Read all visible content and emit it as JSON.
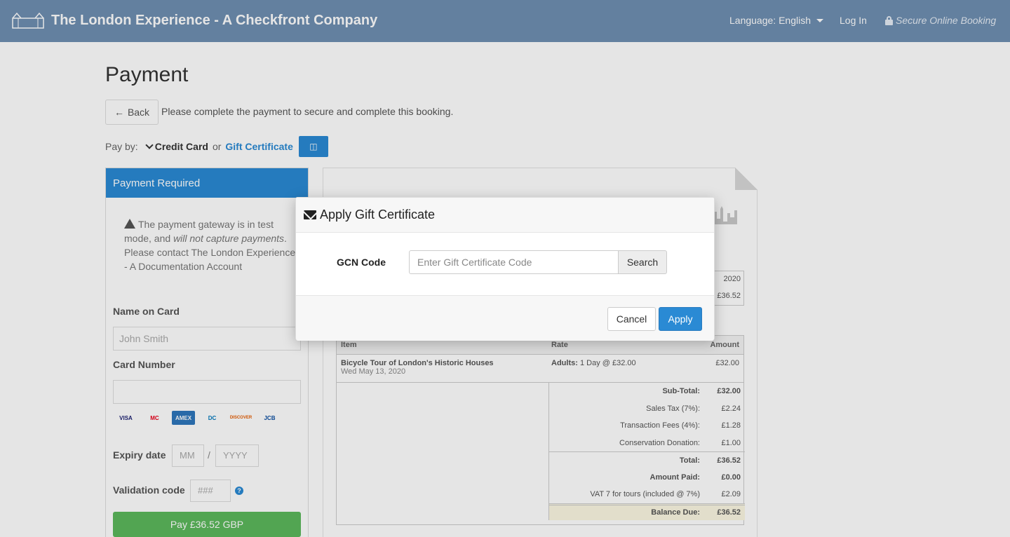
{
  "header": {
    "brand_title": "The London Experience - A Checkfront Company",
    "language": "Language: English",
    "login": "Log In",
    "secure": "Secure Online Booking"
  },
  "page": {
    "title": "Payment",
    "back_label": "Back",
    "instruction": "Please complete the payment to secure and complete this booking.",
    "pay_by_label": "Pay by:",
    "credit_card": "Credit Card",
    "or": "or",
    "gift_certificate": "Gift Certificate"
  },
  "payment_panel": {
    "heading": "Payment Required",
    "warning_parts": {
      "a": "The payment gateway is in test mode, and ",
      "b": "will not capture payments",
      "c": ". Please contact The London Experience - A Documentation Account"
    },
    "name_label": "Name on Card",
    "name_placeholder": "John Smith",
    "card_label": "Card Number",
    "card_placeholder": "",
    "card_types": [
      "VISA",
      "MC",
      "AMEX",
      "DC",
      "DISCOVER",
      "JCB"
    ],
    "expiry_label": "Expiry date",
    "expiry_month_placeholder": "MM",
    "expiry_sep": "/",
    "expiry_year_placeholder": "YYYY",
    "cvv_label": "Validation code",
    "cvv_placeholder": "###",
    "help": "?",
    "pay_button": "Pay £36.52 GBP"
  },
  "invoice": {
    "meta_date": "2020",
    "meta_total": "£36.52",
    "columns": {
      "item": "Item",
      "rate": "Rate",
      "amount": "Amount"
    },
    "line": {
      "item": "Bicycle Tour of London's Historic Houses",
      "date": "Wed May 13, 2020",
      "rate_label": "Adults:",
      "rate_value": "1 Day @ £32.00",
      "amount": "£32.00"
    },
    "totals": [
      {
        "label": "Sub-Total:",
        "value": "£32.00",
        "bold": true
      },
      {
        "label": "Sales Tax (7%):",
        "value": "£2.24",
        "bold": false
      },
      {
        "label": "Transaction Fees (4%):",
        "value": "£1.28",
        "bold": false
      },
      {
        "label": "Conservation Donation:",
        "value": "£1.00",
        "bold": false
      },
      {
        "label": "Total:",
        "value": "£36.52",
        "bold": true
      },
      {
        "label": "Amount Paid:",
        "value": "£0.00",
        "bold": true
      },
      {
        "label": "VAT 7 for tours (included @ 7%)",
        "value": "£2.09",
        "bold": false
      },
      {
        "label": "Balance Due:",
        "value": "£36.52",
        "bold": true
      }
    ]
  },
  "modal": {
    "title": "Apply Gift Certificate",
    "gcn_label": "GCN Code",
    "gcn_placeholder": "Enter Gift Certificate Code",
    "gcn_value": "",
    "search_label": "Search",
    "cancel_label": "Cancel",
    "apply_label": "Apply"
  },
  "colors": {
    "brand_blue": "#2a8ad4",
    "nav_bg": "#6f8fb2",
    "pay_green": "#5cb85c",
    "balance_bg": "#fcf8e3"
  }
}
